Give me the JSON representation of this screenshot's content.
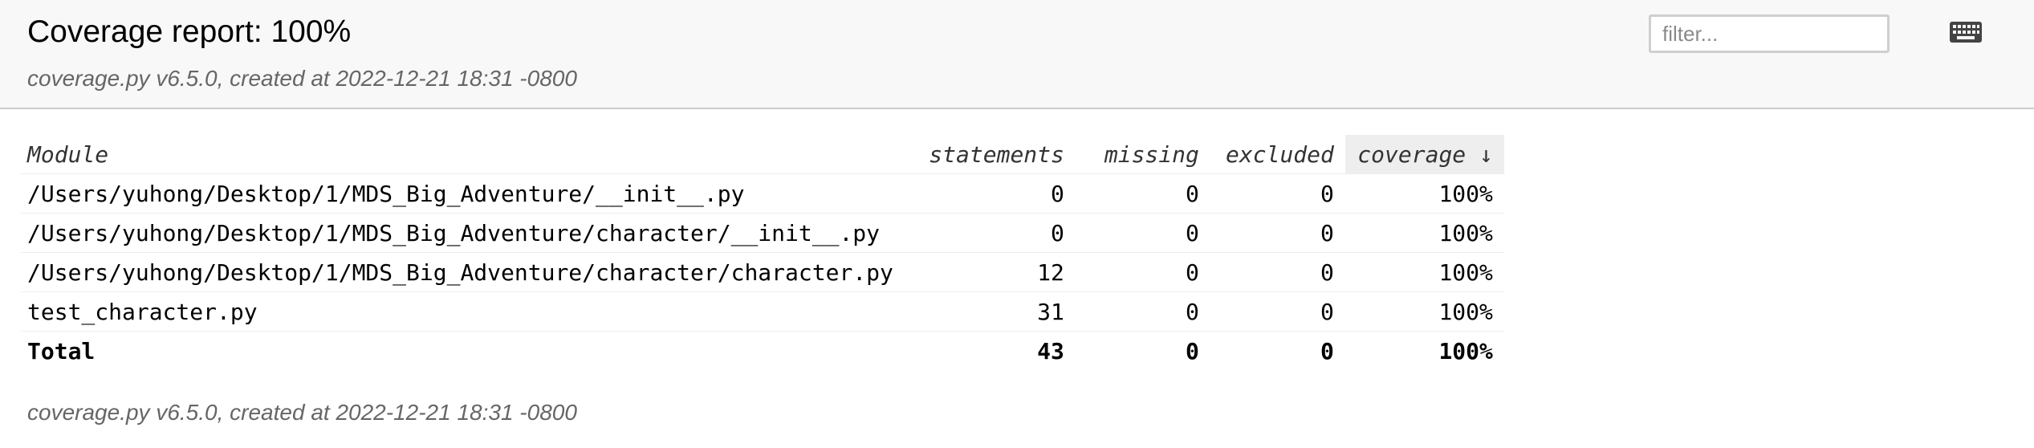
{
  "header": {
    "title": "Coverage report: 100%",
    "created": "coverage.py v6.5.0, created at 2022-12-21 18:31 -0800",
    "filter_placeholder": "filter...",
    "keyboard_icon": "keyboard-icon"
  },
  "table": {
    "columns": {
      "module": "Module",
      "statements": "statements",
      "missing": "missing",
      "excluded": "excluded",
      "coverage": "coverage ↓"
    },
    "rows": [
      {
        "module": "/Users/yuhong/Desktop/1/MDS_Big_Adventure/__init__.py",
        "statements": "0",
        "missing": "0",
        "excluded": "0",
        "coverage": "100%"
      },
      {
        "module": "/Users/yuhong/Desktop/1/MDS_Big_Adventure/character/__init__.py",
        "statements": "0",
        "missing": "0",
        "excluded": "0",
        "coverage": "100%"
      },
      {
        "module": "/Users/yuhong/Desktop/1/MDS_Big_Adventure/character/character.py",
        "statements": "12",
        "missing": "0",
        "excluded": "0",
        "coverage": "100%"
      },
      {
        "module": "test_character.py",
        "statements": "31",
        "missing": "0",
        "excluded": "0",
        "coverage": "100%"
      }
    ],
    "total": {
      "module": "Total",
      "statements": "43",
      "missing": "0",
      "excluded": "0",
      "coverage": "100%"
    }
  },
  "footer": {
    "created": "coverage.py v6.5.0, created at 2022-12-21 18:31 -0800"
  }
}
